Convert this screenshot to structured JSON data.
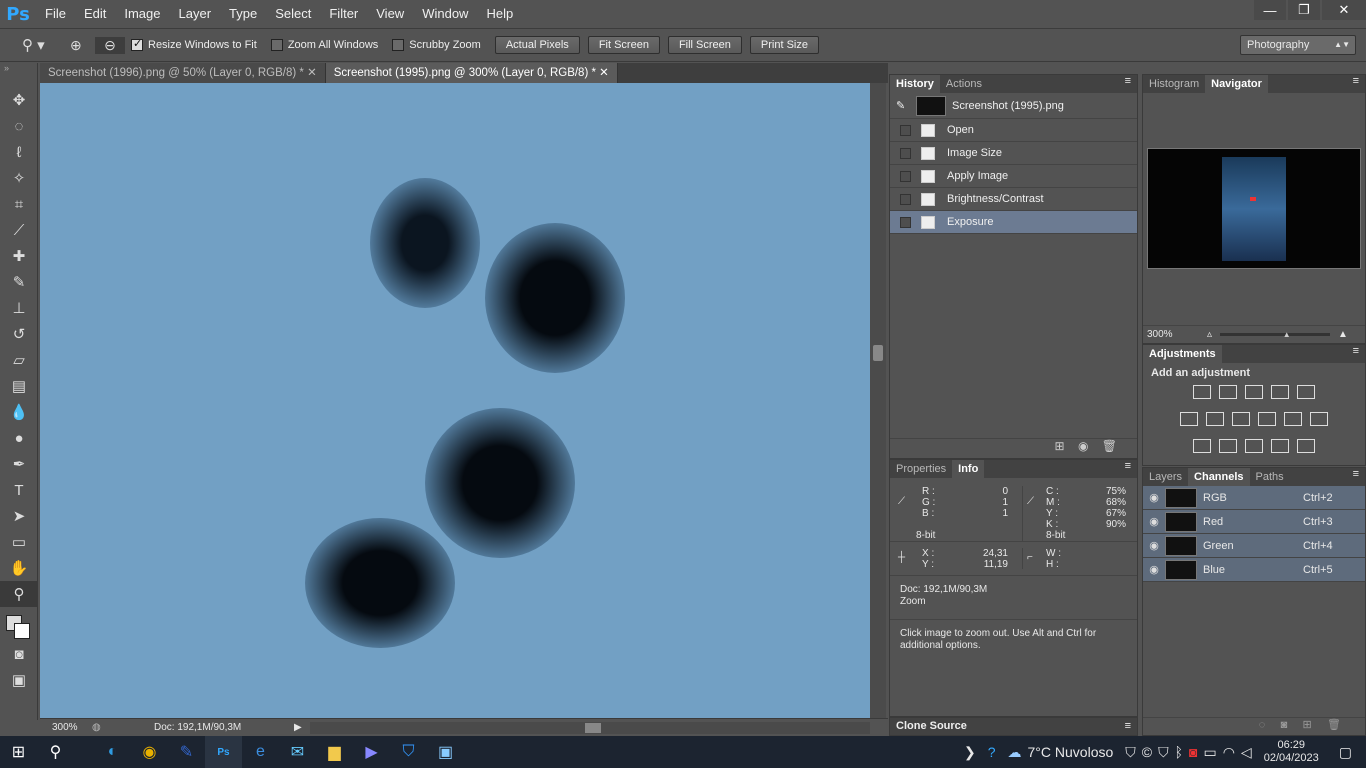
{
  "app": {
    "logo": "Ps"
  },
  "menu": [
    "File",
    "Edit",
    "Image",
    "Layer",
    "Type",
    "Select",
    "Filter",
    "View",
    "Window",
    "Help"
  ],
  "window_controls": {
    "minimize": "—",
    "restore": "❐",
    "close": "✕"
  },
  "options": {
    "resize_windows": "Resize Windows to Fit",
    "zoom_all": "Zoom All Windows",
    "scrubby": "Scrubby Zoom",
    "actual_pixels": "Actual Pixels",
    "fit_screen": "Fit Screen",
    "fill_screen": "Fill Screen",
    "print_size": "Print Size",
    "workspace": "Photography"
  },
  "doctabs": [
    {
      "label": "Screenshot (1996).png @ 50% (Layer 0, RGB/8) *"
    },
    {
      "label": "Screenshot (1995).png @ 300% (Layer 0, RGB/8) *"
    }
  ],
  "status": {
    "zoom": "300%",
    "doc": "Doc: 192,1M/90,3M"
  },
  "history": {
    "tabs": [
      "History",
      "Actions"
    ],
    "snapshot": "Screenshot (1995).png",
    "items": [
      "Open",
      "Image Size",
      "Apply Image",
      "Brightness/Contrast",
      "Exposure"
    ]
  },
  "info": {
    "tabs": [
      "Properties",
      "Info"
    ],
    "R": "0",
    "G": "1",
    "B": "1",
    "C": "75%",
    "M": "68%",
    "Y": "67%",
    "K": "90%",
    "bit1": "8-bit",
    "bit2": "8-bit",
    "X": "24,31",
    "Yc": "11,19",
    "doc": "Doc: 192,1M/90,3M",
    "tool": "Zoom",
    "hint": "Click image to zoom out. Use Alt and Ctrl for additional options."
  },
  "clone": {
    "title": "Clone Source"
  },
  "navigator": {
    "tabs": [
      "Histogram",
      "Navigator"
    ],
    "zoom": "300%"
  },
  "adjustments": {
    "title": "Adjustments",
    "subtitle": "Add an adjustment"
  },
  "channels": {
    "tabs": [
      "Layers",
      "Channels",
      "Paths"
    ],
    "rows": [
      {
        "name": "RGB",
        "key": "Ctrl+2"
      },
      {
        "name": "Red",
        "key": "Ctrl+3"
      },
      {
        "name": "Green",
        "key": "Ctrl+4"
      },
      {
        "name": "Blue",
        "key": "Ctrl+5"
      }
    ]
  },
  "taskbar": {
    "weather": "7°C  Nuvoloso",
    "time": "06:29",
    "date": "02/04/2023"
  }
}
